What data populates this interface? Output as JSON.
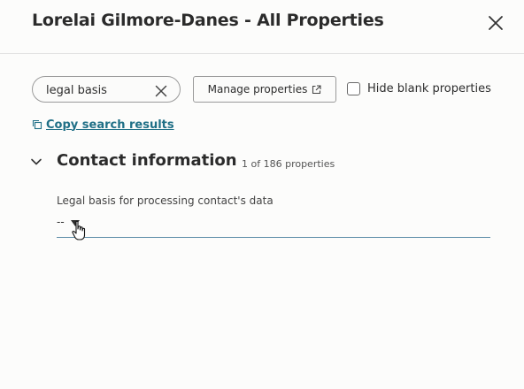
{
  "dialog": {
    "title": "Lorelai Gilmore-Danes - All Properties"
  },
  "toolbar": {
    "search_value": "legal basis",
    "manage_label": "Manage properties",
    "hide_blank_label": "Hide blank properties",
    "hide_blank_checked": false,
    "copy_label": "Copy search results"
  },
  "section": {
    "title": "Contact information",
    "count": "1 of 186 properties",
    "expanded": true
  },
  "field": {
    "label": "Legal basis for processing contact's data",
    "value": "--"
  },
  "colors": {
    "link": "#1f6f86",
    "field_underline": "#5a8aa6"
  }
}
